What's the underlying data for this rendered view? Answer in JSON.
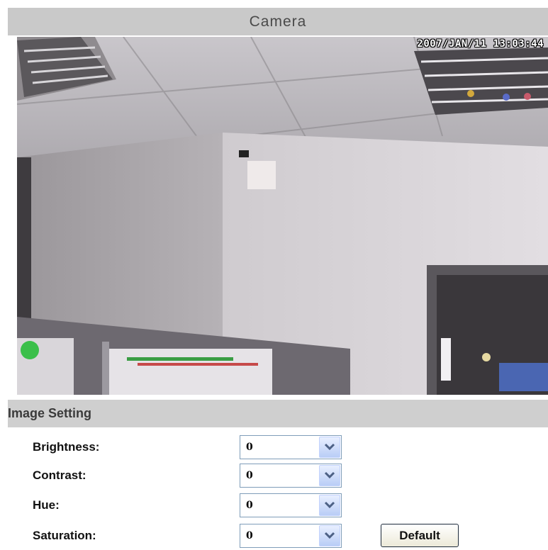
{
  "camera": {
    "title": "Camera",
    "timestamp": "2007/JAN/11 13:03:44"
  },
  "image_setting": {
    "title": "Image Setting",
    "rows": [
      {
        "label": "Brightness:",
        "value": "0"
      },
      {
        "label": "Contrast:",
        "value": "0"
      },
      {
        "label": "Hue:",
        "value": "0"
      },
      {
        "label": "Saturation:",
        "value": "0"
      }
    ],
    "default_label": "Default"
  },
  "icons": {
    "dropdown": "chevron-down-icon"
  }
}
